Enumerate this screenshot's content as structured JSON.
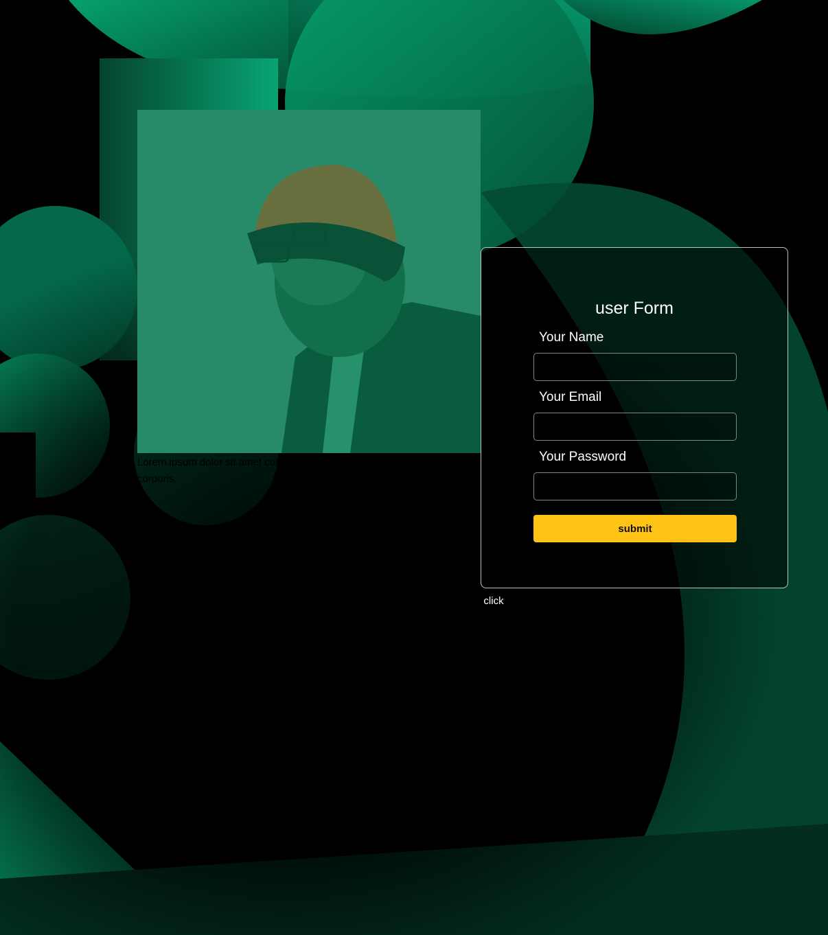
{
  "colors": {
    "background": "#000000",
    "shape_green": "#05865a",
    "photo_green": "#3f9a79",
    "accent_yellow": "#fec315",
    "text_white": "#ffffff"
  },
  "photo": {
    "icon": "portrait-photo"
  },
  "caption": {
    "text": "Lorem ipsum dolor sit amet consectetur adipisicing elit. Accusamus, corporis."
  },
  "form": {
    "title": "user Form",
    "fields": [
      {
        "label": "Your Name",
        "value": "",
        "placeholder": ""
      },
      {
        "label": "Your Email",
        "value": "",
        "placeholder": ""
      },
      {
        "label": "Your Password",
        "value": "",
        "placeholder": ""
      }
    ],
    "submit_label": "submit"
  },
  "click_button": {
    "label": "click"
  }
}
